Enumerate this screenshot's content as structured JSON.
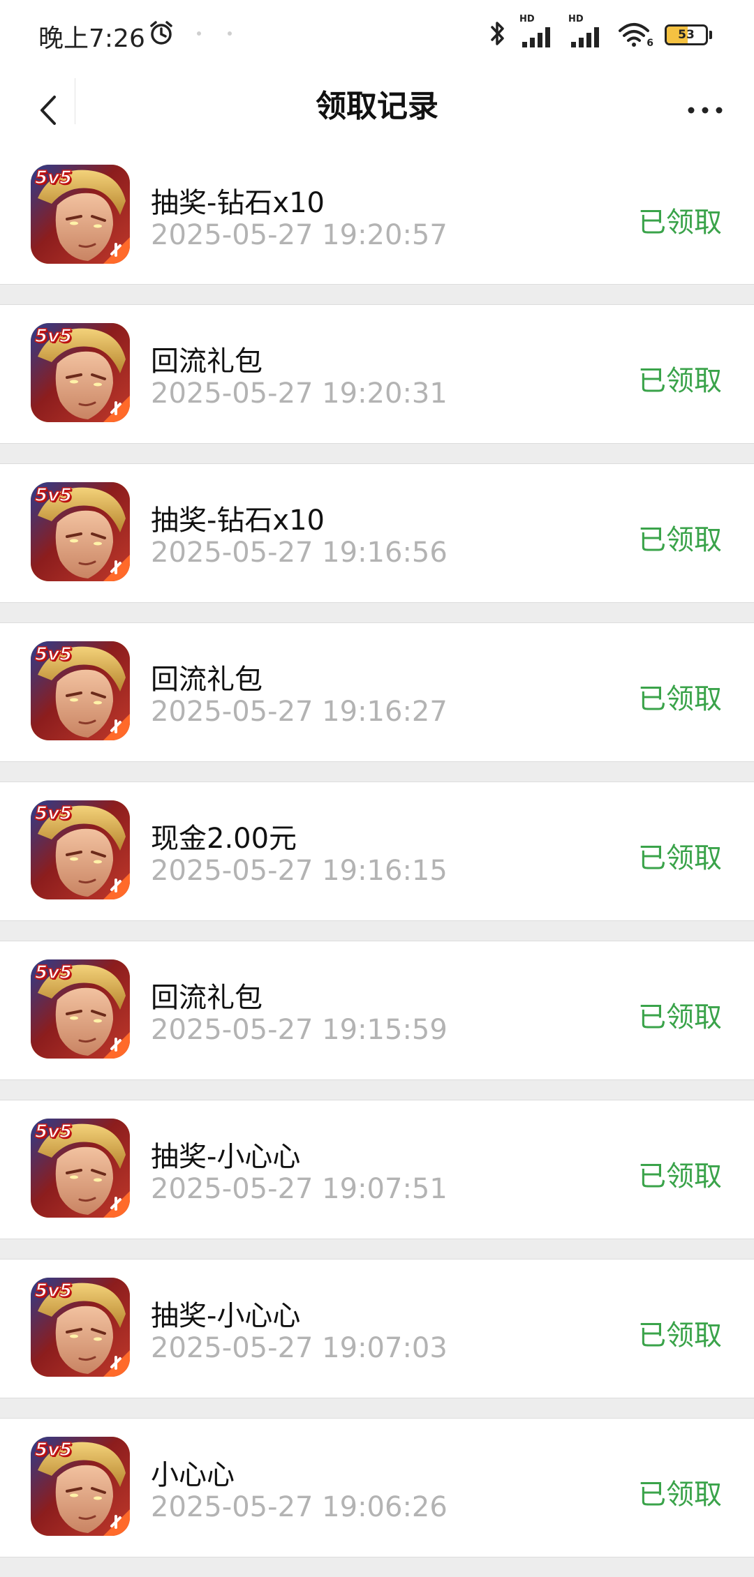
{
  "status_bar": {
    "time": "晚上7:26",
    "network_labels": [
      "HD",
      "HD"
    ],
    "wifi_badge": "6",
    "battery_level": "53",
    "battery_fraction": 0.53,
    "battery_color": "#f5c242"
  },
  "nav": {
    "title": "领取记录",
    "back_icon": "chevron-left-icon",
    "more_icon": "more-horizontal-icon"
  },
  "colors": {
    "status_green": "#3aa34a",
    "time_gray": "#b3b3b3",
    "background": "#ededed"
  },
  "records": [
    {
      "name": "抽奖-钻石x10",
      "time": "2025-05-27 19:20:57",
      "status": "已领取"
    },
    {
      "name": "回流礼包",
      "time": "2025-05-27 19:20:31",
      "status": "已领取"
    },
    {
      "name": "抽奖-钻石x10",
      "time": "2025-05-27 19:16:56",
      "status": "已领取"
    },
    {
      "name": "回流礼包",
      "time": "2025-05-27 19:16:27",
      "status": "已领取"
    },
    {
      "name": "现金2.00元",
      "time": "2025-05-27 19:16:15",
      "status": "已领取"
    },
    {
      "name": "回流礼包",
      "time": "2025-05-27 19:15:59",
      "status": "已领取"
    },
    {
      "name": "抽奖-小心心",
      "time": "2025-05-27 19:07:51",
      "status": "已领取"
    },
    {
      "name": "抽奖-小心心",
      "time": "2025-05-27 19:07:03",
      "status": "已领取"
    },
    {
      "name": "小心心",
      "time": "2025-05-27 19:06:26",
      "status": "已领取"
    }
  ],
  "game_icon": {
    "badge_text": "5v5"
  }
}
